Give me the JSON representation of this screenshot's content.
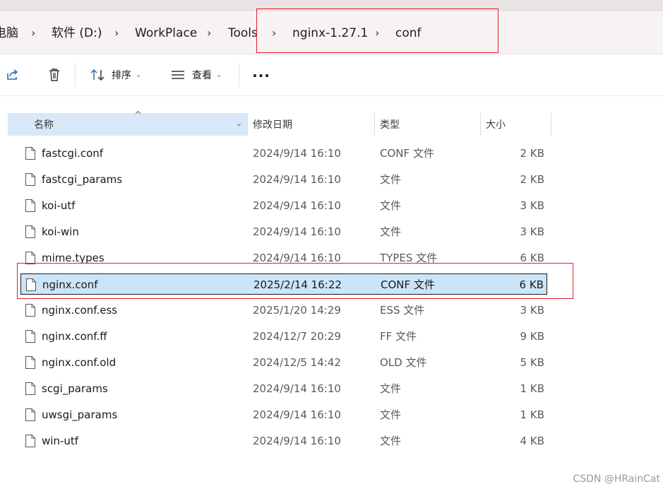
{
  "address": {
    "breadcrumbs": [
      "电脑",
      "软件 (D:)",
      "WorkPlace",
      "Tools",
      "nginx-1.27.1",
      "conf"
    ],
    "separator": "›"
  },
  "toolbar": {
    "share_icon": "share-icon",
    "delete_icon": "trash-icon",
    "sort_label": "排序",
    "view_label": "查看",
    "more_label": "..."
  },
  "columns": {
    "name": "名称",
    "date": "修改日期",
    "type": "类型",
    "size": "大小"
  },
  "files": [
    {
      "name": "fastcgi.conf",
      "date": "2024/9/14 16:10",
      "type": "CONF 文件",
      "size": "2 KB"
    },
    {
      "name": "fastcgi_params",
      "date": "2024/9/14 16:10",
      "type": "文件",
      "size": "2 KB"
    },
    {
      "name": "koi-utf",
      "date": "2024/9/14 16:10",
      "type": "文件",
      "size": "3 KB"
    },
    {
      "name": "koi-win",
      "date": "2024/9/14 16:10",
      "type": "文件",
      "size": "3 KB"
    },
    {
      "name": "mime.types",
      "date": "2024/9/14 16:10",
      "type": "TYPES 文件",
      "size": "6 KB"
    },
    {
      "name": "nginx.conf",
      "date": "2025/2/14 16:22",
      "type": "CONF 文件",
      "size": "6 KB",
      "selected": true
    },
    {
      "name": "nginx.conf.ess",
      "date": "2025/1/20 14:29",
      "type": "ESS 文件",
      "size": "3 KB"
    },
    {
      "name": "nginx.conf.ff",
      "date": "2024/12/7 20:29",
      "type": "FF 文件",
      "size": "9 KB"
    },
    {
      "name": "nginx.conf.old",
      "date": "2024/12/5 14:42",
      "type": "OLD 文件",
      "size": "5 KB"
    },
    {
      "name": "scgi_params",
      "date": "2024/9/14 16:10",
      "type": "文件",
      "size": "1 KB"
    },
    {
      "name": "uwsgi_params",
      "date": "2024/9/14 16:10",
      "type": "文件",
      "size": "1 KB"
    },
    {
      "name": "win-utf",
      "date": "2024/9/14 16:10",
      "type": "文件",
      "size": "4 KB"
    }
  ],
  "watermark": "CSDN @HRainCat",
  "colors": {
    "selection": "#cce4f7",
    "sorted_header": "#d8e8f8",
    "highlight_box": "#e0212b",
    "address_bg": "#f7f3f3"
  }
}
